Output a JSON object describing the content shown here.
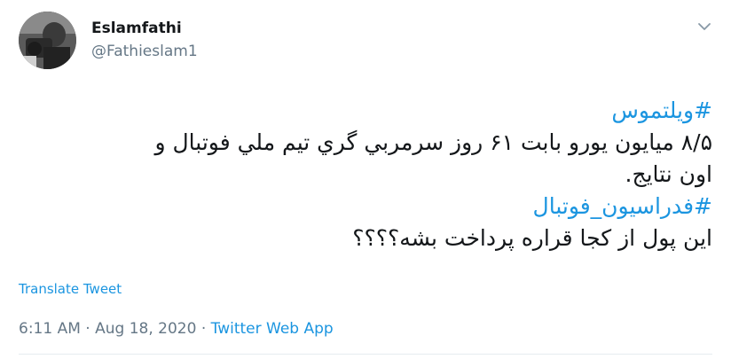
{
  "user": {
    "display_name": "Eslamfathi",
    "handle": "@Fathieslam1"
  },
  "tweet": {
    "hashtag1": "#ویلتموس",
    "line1": "۸/۵ میایون یورو بابت ۶۱ روز سرمربي گري تیم ملي فوتبال و",
    "line2": "اون نتایج.",
    "hashtag2": "#فدراسیون_فوتبال",
    "line3": "این پول از کجا قراره پرداخت بشه؟؟؟؟"
  },
  "actions": {
    "translate_label": "Translate Tweet"
  },
  "meta": {
    "time": "6:11 AM",
    "sep1": " · ",
    "date": "Aug 18, 2020",
    "sep2": " · ",
    "source": "Twitter Web App"
  },
  "icons": {
    "caret": "chevron-down-icon",
    "avatar": "avatar"
  },
  "colors": {
    "link": "#1b95e0",
    "secondary_text": "#657786",
    "primary_text": "#14171a"
  }
}
